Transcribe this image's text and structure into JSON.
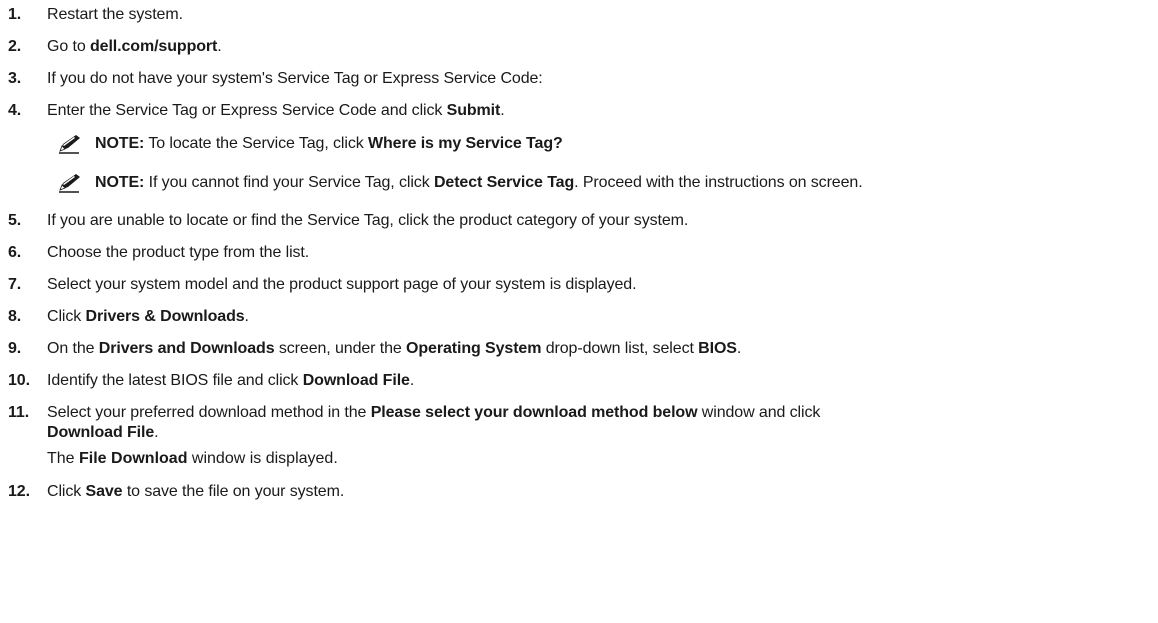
{
  "steps": [
    {
      "num": "1.",
      "segments": [
        {
          "t": "Restart the system.",
          "b": false
        }
      ]
    },
    {
      "num": "2.",
      "segments": [
        {
          "t": "Go to ",
          "b": false
        },
        {
          "t": "dell.com/support",
          "b": true
        },
        {
          "t": ".",
          "b": false
        }
      ]
    },
    {
      "num": "3.",
      "segments": [
        {
          "t": "If you do not have your system's Service Tag or Express Service Code:",
          "b": false
        }
      ]
    },
    {
      "num": "4.",
      "segments": [
        {
          "t": "Enter the Service Tag or Express Service Code and click ",
          "b": false
        },
        {
          "t": "Submit",
          "b": true
        },
        {
          "t": ".",
          "b": false
        }
      ]
    },
    {
      "num": "5.",
      "segments": [
        {
          "t": "If you are unable to locate or find the Service Tag, click the product category of your system.",
          "b": false
        }
      ]
    },
    {
      "num": "6.",
      "segments": [
        {
          "t": "Choose the product type from the list.",
          "b": false
        }
      ]
    },
    {
      "num": "7.",
      "segments": [
        {
          "t": "Select your system model and the product support page of your system is displayed.",
          "b": false
        }
      ]
    },
    {
      "num": "8.",
      "segments": [
        {
          "t": "Click ",
          "b": false
        },
        {
          "t": "Drivers & Downloads",
          "b": true
        },
        {
          "t": ".",
          "b": false
        }
      ]
    },
    {
      "num": "9.",
      "segments": [
        {
          "t": "On the ",
          "b": false
        },
        {
          "t": "Drivers and Downloads",
          "b": true
        },
        {
          "t": " screen, under the ",
          "b": false
        },
        {
          "t": "Operating System",
          "b": true
        },
        {
          "t": " drop-down list, select ",
          "b": false
        },
        {
          "t": "BIOS",
          "b": true
        },
        {
          "t": ".",
          "b": false
        }
      ]
    },
    {
      "num": "10.",
      "segments": [
        {
          "t": "Identify the latest BIOS file and click ",
          "b": false
        },
        {
          "t": "Download File",
          "b": true
        },
        {
          "t": ".",
          "b": false
        }
      ]
    },
    {
      "num": "11.",
      "segments": [
        {
          "t": "Select your preferred download method in the ",
          "b": false
        },
        {
          "t": "Please select your download method below",
          "b": true
        },
        {
          "t": " window and click",
          "b": false
        }
      ],
      "line2": [
        {
          "t": "Download File",
          "b": true
        },
        {
          "t": ".",
          "b": false
        }
      ],
      "sub": [
        {
          "t": "The ",
          "b": false
        },
        {
          "t": "File Download",
          "b": true
        },
        {
          "t": " window is displayed.",
          "b": false
        }
      ]
    },
    {
      "num": "12.",
      "segments": [
        {
          "t": "Click ",
          "b": false
        },
        {
          "t": "Save",
          "b": true
        },
        {
          "t": " to save the file on your system.",
          "b": false
        }
      ]
    }
  ],
  "notes": [
    {
      "segments": [
        {
          "t": "NOTE:",
          "b": true
        },
        {
          "t": " To locate the Service Tag, click ",
          "b": false
        },
        {
          "t": "Where is my Service Tag?",
          "b": true
        }
      ]
    },
    {
      "segments": [
        {
          "t": "NOTE:",
          "b": true
        },
        {
          "t": " If you cannot find your Service Tag, click ",
          "b": false
        },
        {
          "t": "Detect Service Tag",
          "b": true
        },
        {
          "t": ". Proceed with the instructions on screen.",
          "b": false
        }
      ]
    }
  ]
}
